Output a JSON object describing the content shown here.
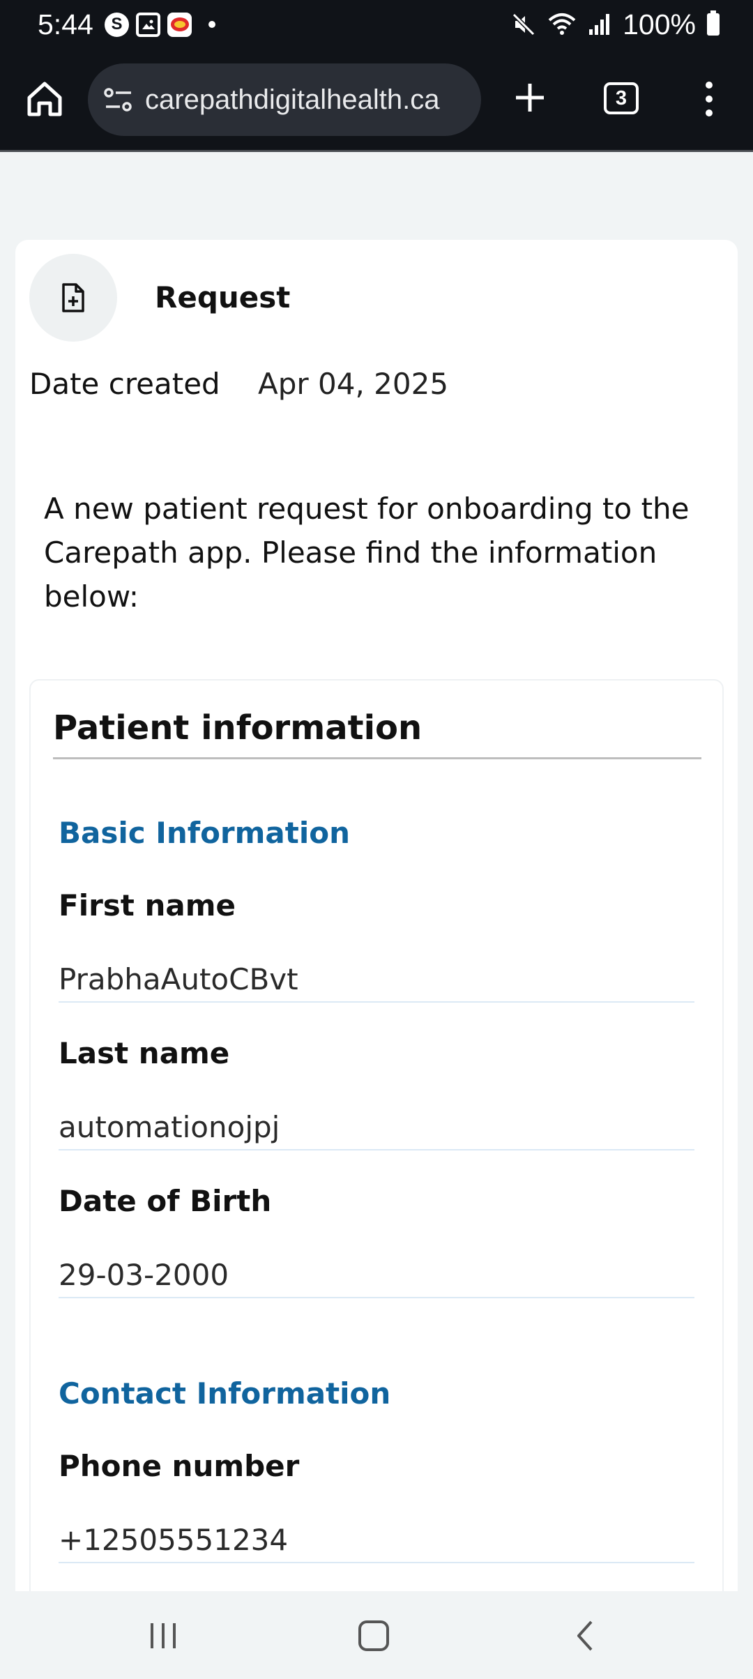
{
  "status": {
    "time": "5:44",
    "battery": "100%",
    "icons": [
      "s-app-icon",
      "gallery-icon",
      "game-app-icon",
      "dot-icon",
      "mute-icon",
      "wifi-icon",
      "signal-icon",
      "battery-icon"
    ]
  },
  "browser": {
    "url": "carepathdigitalhealth.ca",
    "tab_count": "3"
  },
  "request": {
    "title": "Request",
    "date_label": "Date created",
    "date_value": "Apr 04, 2025",
    "intro": "A new patient request for onboarding to the Carepath app. Please find the information below:"
  },
  "patient": {
    "title": "Patient information",
    "basic_section": "Basic Information",
    "contact_section": "Contact Information",
    "fields": [
      {
        "label": "First name",
        "value": "PrabhaAutoCBvt"
      },
      {
        "label": "Last name",
        "value": "automationojpj"
      },
      {
        "label": "Date of Birth",
        "value": "29-03-2000"
      },
      {
        "label": "Phone number",
        "value": "+12505551234"
      }
    ]
  },
  "colors": {
    "accent": "#10649e",
    "bar": "#101318",
    "background": "#f1f4f5"
  }
}
